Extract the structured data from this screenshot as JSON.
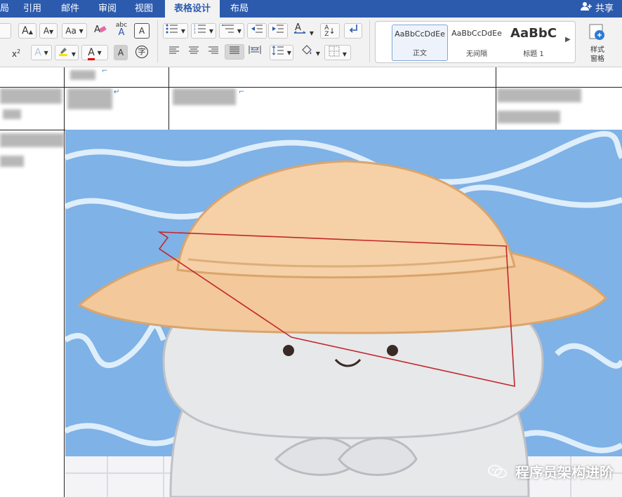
{
  "menubar": {
    "items": [
      "局",
      "引用",
      "邮件",
      "审阅",
      "视图",
      "表格设计",
      "布局"
    ],
    "share_label": "共享"
  },
  "ribbon": {
    "font_grow": "A",
    "font_shrink": "A",
    "change_case": "Aa",
    "phonetic_top": "abc",
    "phonetic_bottom": "A",
    "char_border": "A",
    "superscript": "x",
    "superscript_exp": "2",
    "text_effect": "A",
    "font_color": "A",
    "char_shading": "A",
    "enclose_char": "字",
    "sort_top": "A",
    "sort_bottom": "Z",
    "styles": [
      {
        "preview": "AaBbCcDdEe",
        "label": "正文"
      },
      {
        "preview": "AaBbCcDdEe",
        "label": "无间隔"
      },
      {
        "preview": "AaBbC",
        "label": "标题 1"
      }
    ],
    "styles_pane_line1": "样式",
    "styles_pane_line2": "窗格"
  },
  "document": {
    "watermark": "程序员架构进阶"
  },
  "colors": {
    "menubar_bg": "#2c5bae",
    "ribbon_bg": "#f2f2f2",
    "annotation_red": "#c0282d",
    "picture_sky": "#7fb2e6",
    "hat": "#f3c89a",
    "character": "#e7e8ea"
  }
}
